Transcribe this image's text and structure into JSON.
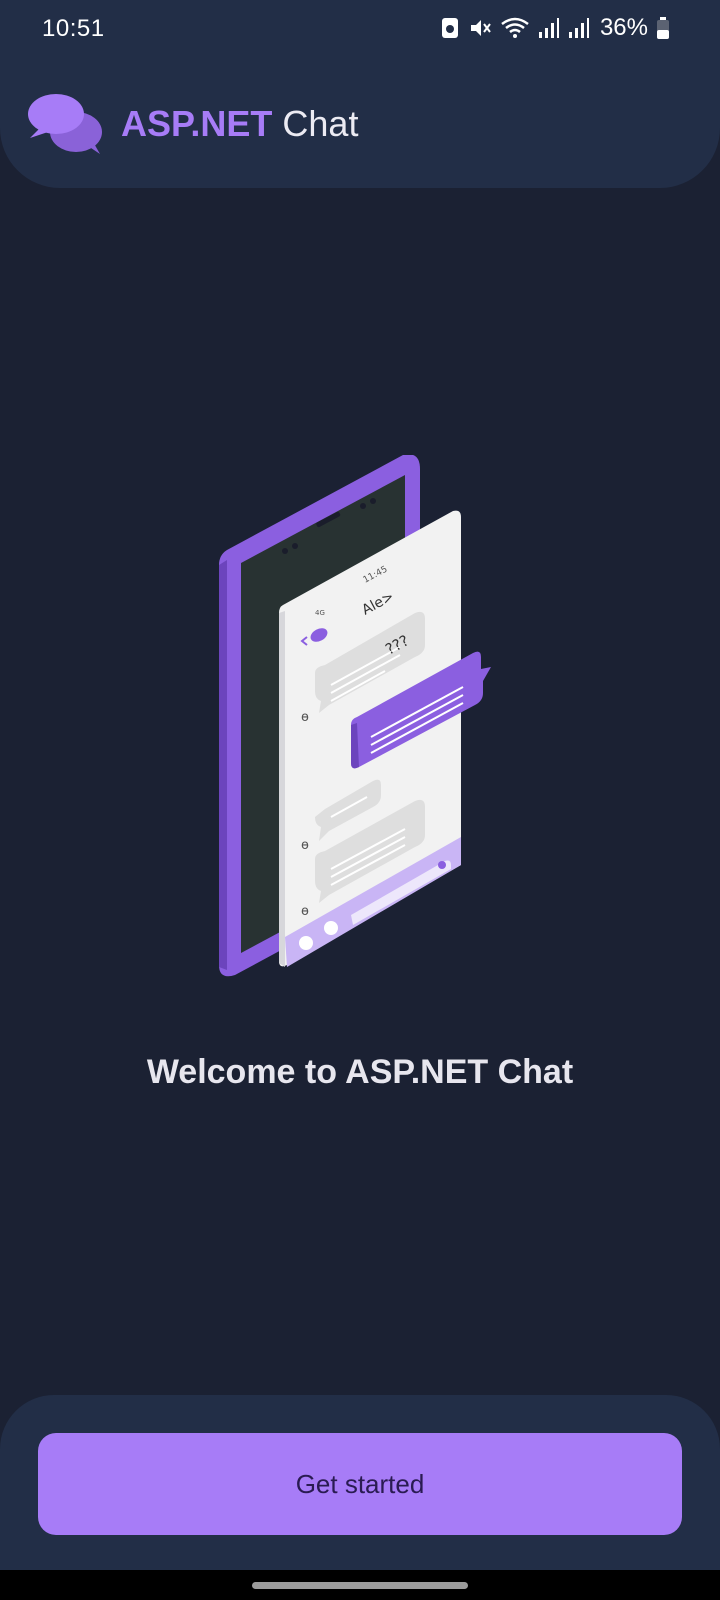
{
  "status_bar": {
    "time": "10:51",
    "battery": "36%",
    "icons": [
      "notification-icon",
      "mute-icon",
      "wifi-icon",
      "signal-icon",
      "signal-icon",
      "battery-icon"
    ]
  },
  "header": {
    "brand_accent": "ASP.NET",
    "brand_rest": "Chat",
    "logo_icon": "chat-bubbles-icon"
  },
  "illustration": {
    "icon": "phone-chat-illustration",
    "phone_time": "11:45",
    "contact": "Ale>",
    "bubble_text": "???",
    "signal": "4G"
  },
  "welcome": {
    "title": "Welcome to ASP.NET Chat"
  },
  "cta": {
    "label": "Get started"
  },
  "colors": {
    "background": "#1b2133",
    "panel": "#222e47",
    "accent": "#a77cf7",
    "button_text": "#2a1b52"
  }
}
